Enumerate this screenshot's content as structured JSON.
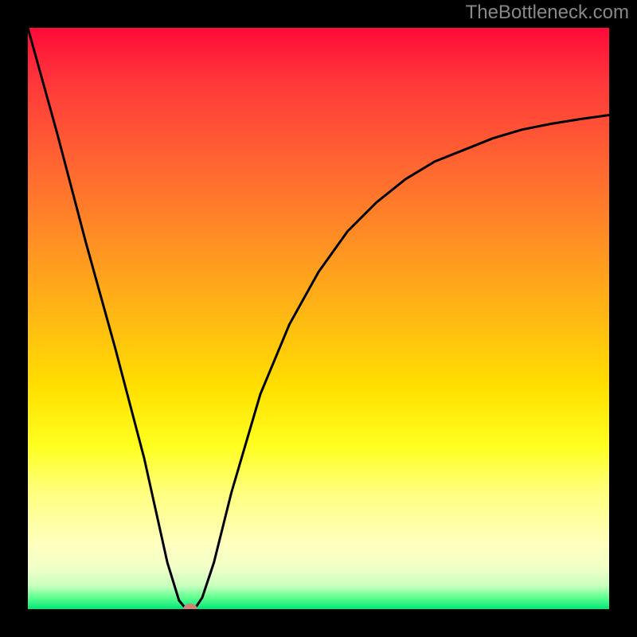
{
  "watermark": "TheBottleneck.com",
  "chart_data": {
    "type": "line",
    "title": "",
    "xlabel": "",
    "ylabel": "",
    "xlim": [
      0,
      100
    ],
    "ylim": [
      0,
      100
    ],
    "grid": false,
    "series": [
      {
        "name": "curve",
        "x": [
          0,
          5,
          10,
          15,
          20,
          24,
          26,
          27,
          28,
          29,
          30,
          32,
          35,
          40,
          45,
          50,
          55,
          60,
          65,
          70,
          75,
          80,
          85,
          90,
          95,
          100
        ],
        "values": [
          100,
          82,
          63,
          45,
          26,
          8,
          1.5,
          0.3,
          0,
          0.5,
          2,
          8,
          20,
          37,
          49,
          58,
          65,
          70,
          74,
          77,
          79,
          81,
          82.5,
          83.5,
          84.3,
          85
        ]
      }
    ],
    "marker": {
      "x": 28,
      "y": 0
    },
    "background_gradient": {
      "top_color": "#ff0a3a",
      "mid_color": "#ffe000",
      "bottom_color": "#00e878"
    }
  }
}
